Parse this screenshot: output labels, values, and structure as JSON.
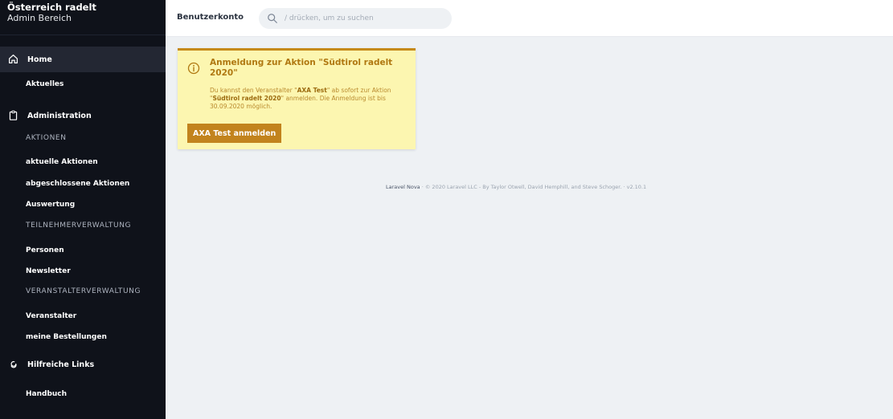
{
  "sidebar": {
    "title": "Österreich radelt",
    "subtitle": "Admin Bereich",
    "home": {
      "label": "Home",
      "icon": "home-icon"
    },
    "aktuelles": "Aktuelles",
    "administration": {
      "label": "Administration",
      "icon": "clipboard-icon"
    },
    "aktionen_heading": "AKTIONEN",
    "aktionen_items": [
      "aktuelle Aktionen",
      "abgeschlossene Aktionen",
      "Auswertung"
    ],
    "teilnehmer_heading": "TEILNEHMERVERWALTUNG",
    "teilnehmer_items": [
      "Personen",
      "Newsletter"
    ],
    "veranstalter_heading": "VERANSTALTERVERWALTUNG",
    "veranstalter_items": [
      "Veranstalter",
      "meine Bestellungen"
    ],
    "links": {
      "label": "Hilfreiche Links",
      "icon": "link-icon"
    },
    "handbuch": "Handbuch"
  },
  "topbar": {
    "account_label": "Benutzerkonto",
    "search_placeholder": "/ drücken, um zu suchen",
    "search_icon": "search-icon"
  },
  "alert": {
    "icon": "info-icon",
    "title": "Anmeldung zur Aktion \"Südtirol radelt 2020\"",
    "body_part1": "Du kannst den Veranstalter \"",
    "body_org": "AXA Test",
    "body_part2": "\" ab sofort zur Aktion \"",
    "body_action": "Südtirol radelt 2020",
    "body_part3": "\" anmelden. Die Anmeldung ist bis 30.09.2020 möglich.",
    "button_label": "AXA Test anmelden"
  },
  "footer": {
    "brand": "Laravel Nova",
    "text": "· © 2020 Laravel LLC - By Taylor Otwell, David Hemphill, and Steve Schoger. · v2.10.1"
  },
  "colors": {
    "sidebar_bg": "#0f121a",
    "alert_bg": "#fcf6b0",
    "alert_accent": "#c68a1a",
    "button_bg": "#c2831d"
  }
}
